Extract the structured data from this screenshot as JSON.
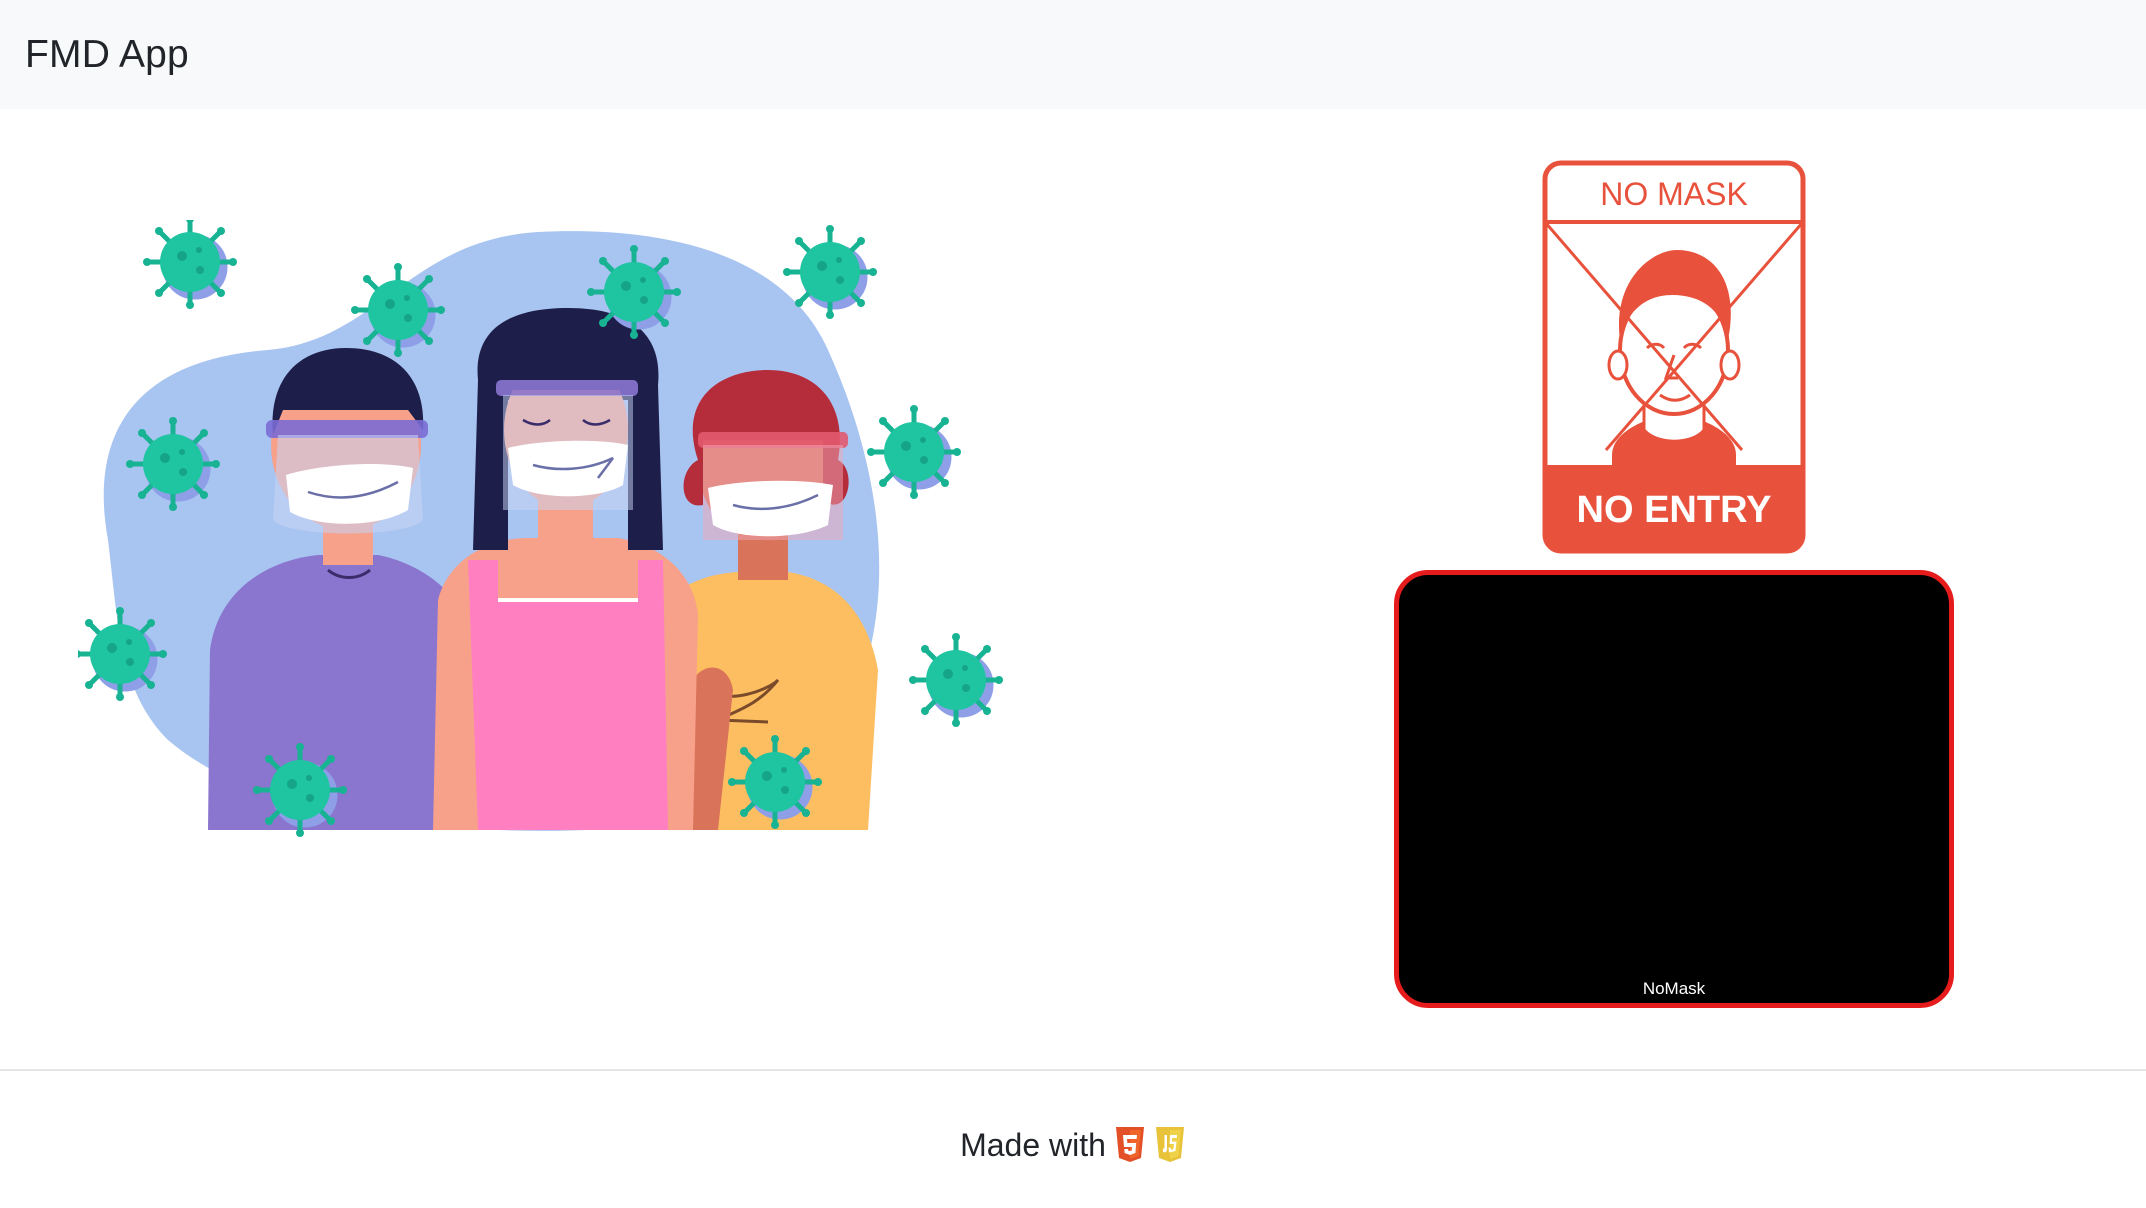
{
  "navbar": {
    "brand": "FMD App"
  },
  "sign": {
    "top_text": "NO MASK",
    "bottom_text": "NO ENTRY"
  },
  "video": {
    "label": "NoMask"
  },
  "footer": {
    "text": "Made with",
    "icons": [
      "html5-icon",
      "javascript-icon"
    ]
  },
  "colors": {
    "accent_red": "#e61b1b",
    "sign_red": "#e8523c",
    "virus_teal": "#1abc9c"
  }
}
